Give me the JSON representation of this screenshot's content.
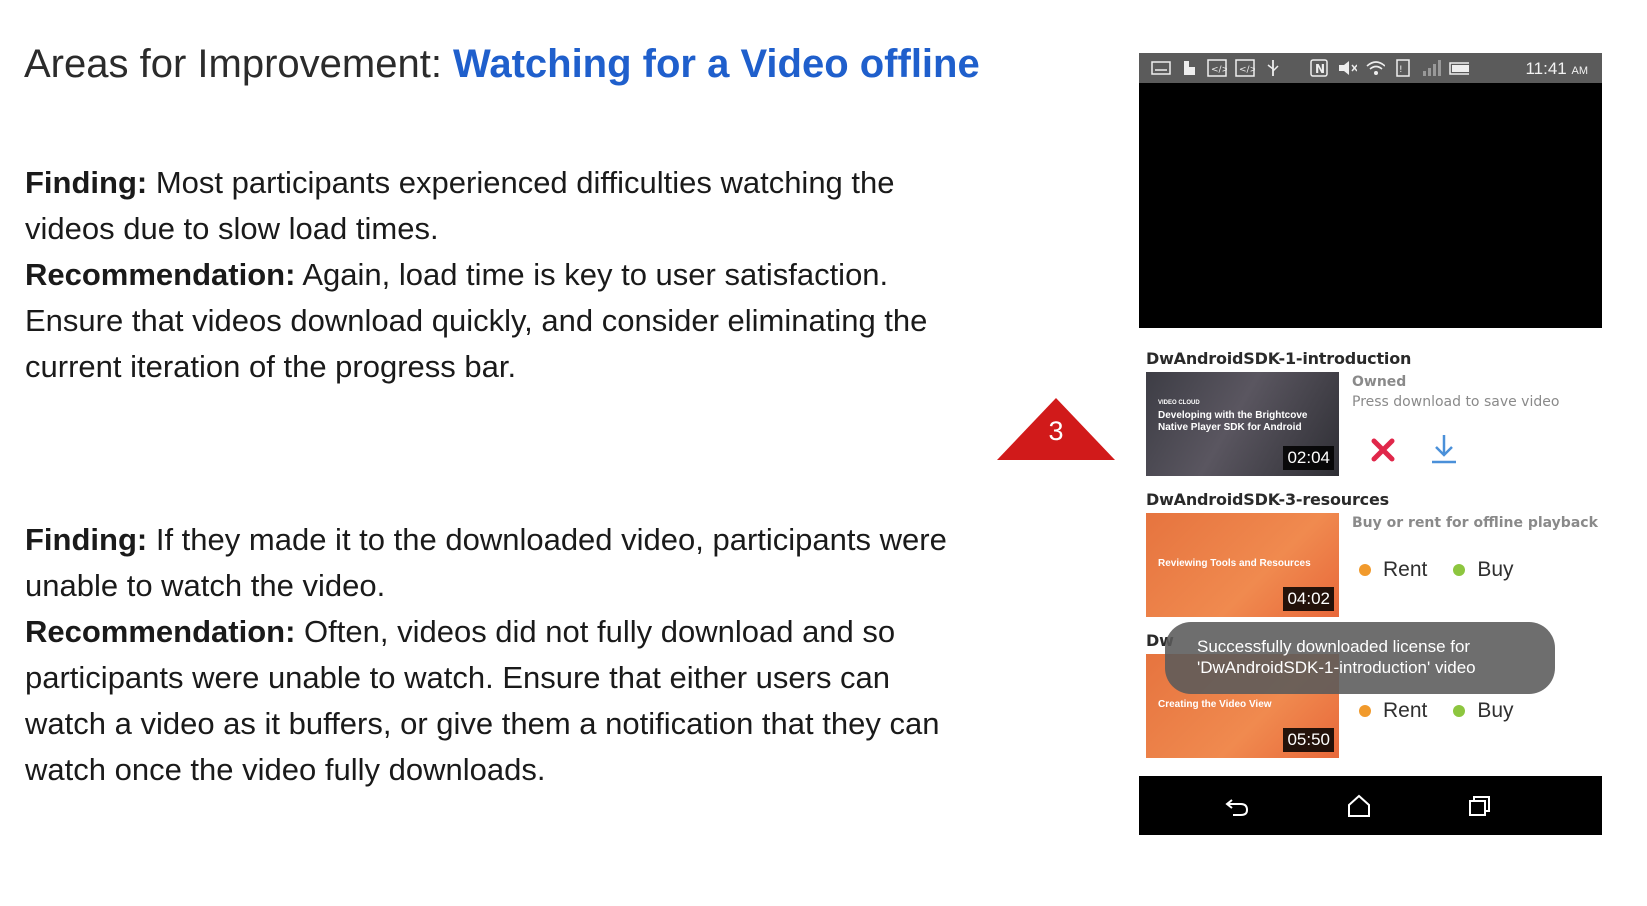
{
  "slide": {
    "title_prefix": "Areas for Improvement: ",
    "title_accent": "Watching for a Video offline"
  },
  "findings": [
    {
      "finding_label": "Finding:",
      "finding_text": " Most participants experienced difficulties watching the videos due to slow load times.",
      "recommendation_label": "Recommendation:",
      "recommendation_text": " Again, load time is key to user satisfaction. Ensure that videos download quickly, and consider eliminating the current iteration of the progress bar."
    },
    {
      "finding_label": "Finding:",
      "finding_text": " If they made it to the downloaded video, participants were unable to watch the video.",
      "recommendation_label": "Recommendation:",
      "recommendation_text": " Often, videos did not fully download and so participants were unable to watch. Ensure that either users can watch a video as it buffers, or give them a notification that they can watch once the video fully downloads."
    }
  ],
  "step_marker": {
    "number": "3",
    "color": "#d11a1a"
  },
  "phone": {
    "status_bar": {
      "time": "11:41",
      "ampm": "AM"
    },
    "items": [
      {
        "title": "DwAndroidSDK-1-introduction",
        "thumb_brand": "VIDEO CLOUD",
        "thumb_text": "Developing with the Brightcove Native Player SDK for Android",
        "duration": "02:04",
        "status": "Owned",
        "hint": "Press download to save video"
      },
      {
        "title": "DwAndroidSDK-3-resources",
        "thumb_text": "Reviewing Tools and Resources",
        "duration": "04:02",
        "hint": "Buy or rent for offline playback",
        "rent_label": "Rent",
        "buy_label": "Buy"
      },
      {
        "title": "Dw",
        "thumb_text": "Creating the Video View",
        "duration": "05:50",
        "rent_label": "Rent",
        "buy_label": "Buy"
      }
    ],
    "toast": {
      "line1": "Successfully downloaded license for",
      "line2": "'DwAndroidSDK-1-introduction' video"
    },
    "nav": [
      "back-icon",
      "home-icon",
      "recents-icon"
    ]
  },
  "colors": {
    "accent_title": "#1f5fcc",
    "delete_icon": "#e0274a",
    "download_icon": "#4a90d9",
    "rent_dot": "#f19a2c",
    "buy_dot": "#8dc63f"
  }
}
